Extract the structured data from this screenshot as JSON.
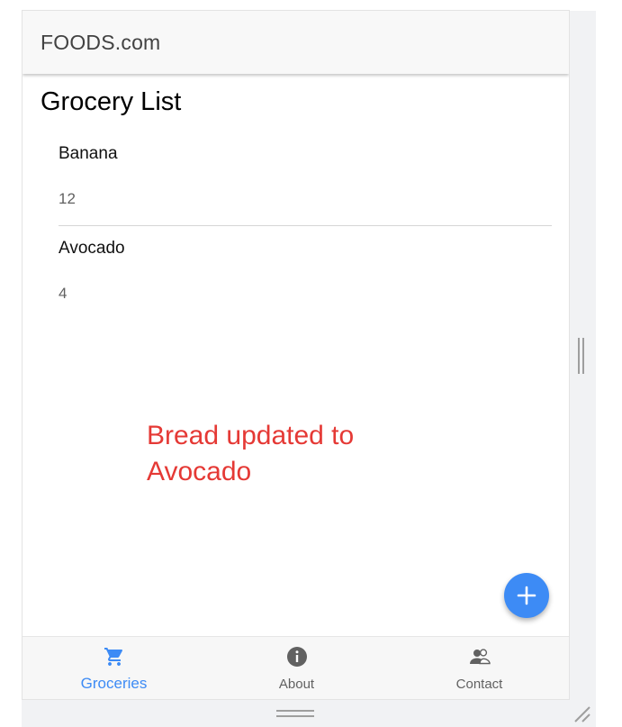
{
  "app": {
    "title": "FOODS.com"
  },
  "page": {
    "title": "Grocery List"
  },
  "groceries": [
    {
      "name": "Banana",
      "quantity": "12"
    },
    {
      "name": "Avocado",
      "quantity": "4"
    }
  ],
  "toast": {
    "message": "Bread updated to Avocado",
    "color": "#e53935"
  },
  "fab": {
    "icon": "plus-icon",
    "color": "#3d8bf5"
  },
  "tabs": [
    {
      "label": "Groceries",
      "icon": "cart-icon",
      "active": true
    },
    {
      "label": "About",
      "icon": "info-icon",
      "active": false
    },
    {
      "label": "Contact",
      "icon": "people-icon",
      "active": false
    }
  ],
  "colors": {
    "accent": "#3d8bf5",
    "header_bg": "#f8f8f8"
  }
}
